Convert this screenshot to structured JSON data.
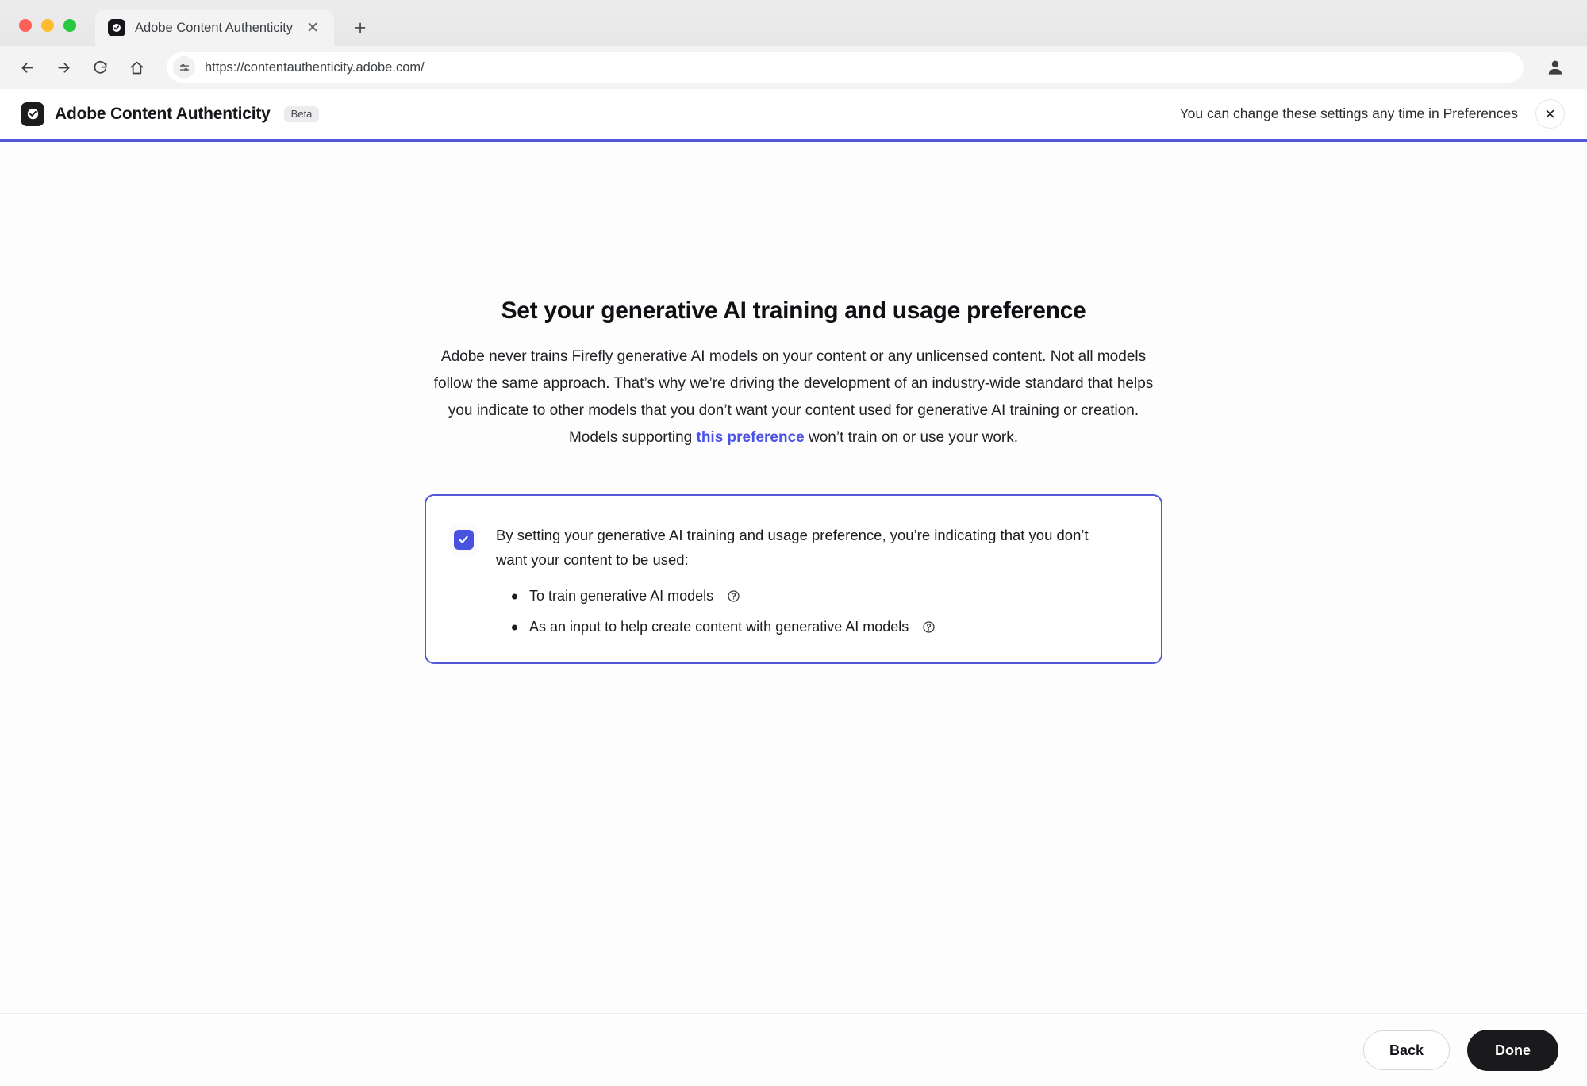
{
  "browser": {
    "tab": {
      "title": "Adobe Content Authenticity",
      "favicon_icon": "adobe-content-credentials-icon",
      "close_icon": "close-icon"
    },
    "new_tab_icon": "plus-icon",
    "toolbar": {
      "back_icon": "arrow-left-icon",
      "forward_icon": "arrow-right-icon",
      "reload_icon": "reload-icon",
      "home_icon": "home-icon",
      "site_settings_icon": "sliders-icon",
      "url": "https://contentauthenticity.adobe.com/",
      "profile_icon": "user-avatar-icon"
    }
  },
  "header": {
    "logo_icon": "adobe-content-credentials-icon",
    "brand": "Adobe Content Authenticity",
    "badge": "Beta",
    "note": "You can change these settings any time in Preferences",
    "close_icon": "close-icon",
    "accent_color": "#5258d8"
  },
  "main": {
    "title": "Set your generative AI training and usage preference",
    "description_part1": "Adobe never trains Firefly generative AI models on your content or any unlicensed content. Not all models follow the same approach. That’s why we’re driving the development of an industry-wide standard that helps you indicate to other models that you don’t want your content used for generative AI training or creation. Models supporting ",
    "description_link": "this preference",
    "description_part2": " won’t train on or use your work.",
    "card": {
      "checkbox_checked": true,
      "checkbox_color": "#4a50e0",
      "border_color": "#5258d8",
      "lead": "By setting your generative AI training and usage preference, you’re indicating that you don’t want your content to be used:",
      "items": [
        {
          "label": "To train generative AI models",
          "help_icon": "help-circle-icon"
        },
        {
          "label": "As an input to help create content with generative AI models",
          "help_icon": "help-circle-icon"
        }
      ]
    }
  },
  "footer": {
    "back_label": "Back",
    "done_label": "Done"
  }
}
